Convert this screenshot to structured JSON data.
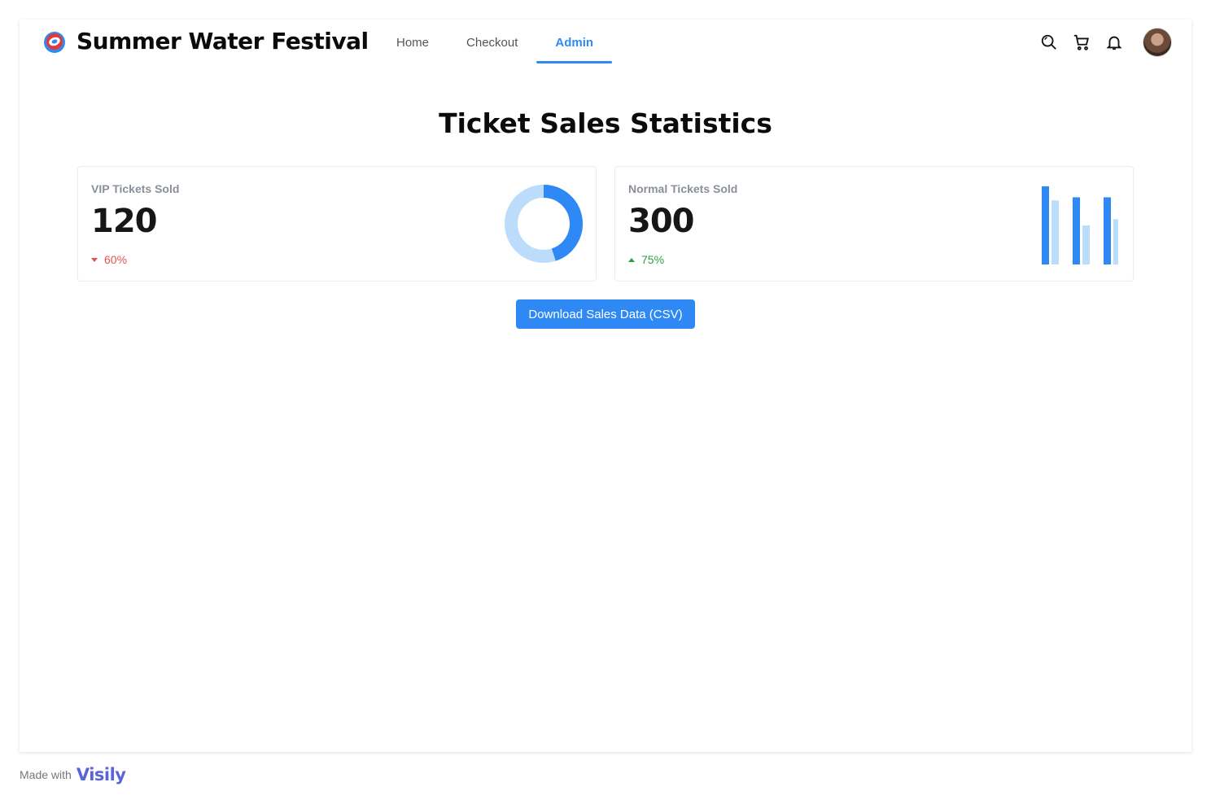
{
  "header": {
    "title": "Summer Water Festival",
    "logo_icon": "festival-logo-icon",
    "nav": [
      {
        "label": "Home",
        "active": false
      },
      {
        "label": "Checkout",
        "active": false
      },
      {
        "label": "Admin",
        "active": true
      }
    ],
    "icons": [
      "search-icon",
      "cart-icon",
      "bell-icon",
      "avatar"
    ]
  },
  "main": {
    "title": "Ticket Sales Statistics",
    "cards": [
      {
        "label": "VIP Tickets Sold",
        "value": "120",
        "change": "60%",
        "trend": "down",
        "chart": {
          "type": "donut",
          "fraction_highlighted": 0.45
        }
      },
      {
        "label": "Normal Tickets Sold",
        "value": "300",
        "change": "75%",
        "trend": "up",
        "chart": {
          "type": "bar",
          "series": [
            {
              "values": [
                1.0,
                0.86,
                0.86
              ]
            },
            {
              "values": [
                0.82,
                0.5,
                0.58
              ]
            }
          ]
        }
      }
    ],
    "download_label": "Download Sales Data (CSV)"
  },
  "footer": {
    "made_with": "Made with",
    "brand": "Visily"
  },
  "colors": {
    "accent": "#2f89f5",
    "accent_light": "#bcdcfb",
    "down": "#e05252",
    "up": "#2e9e47"
  }
}
